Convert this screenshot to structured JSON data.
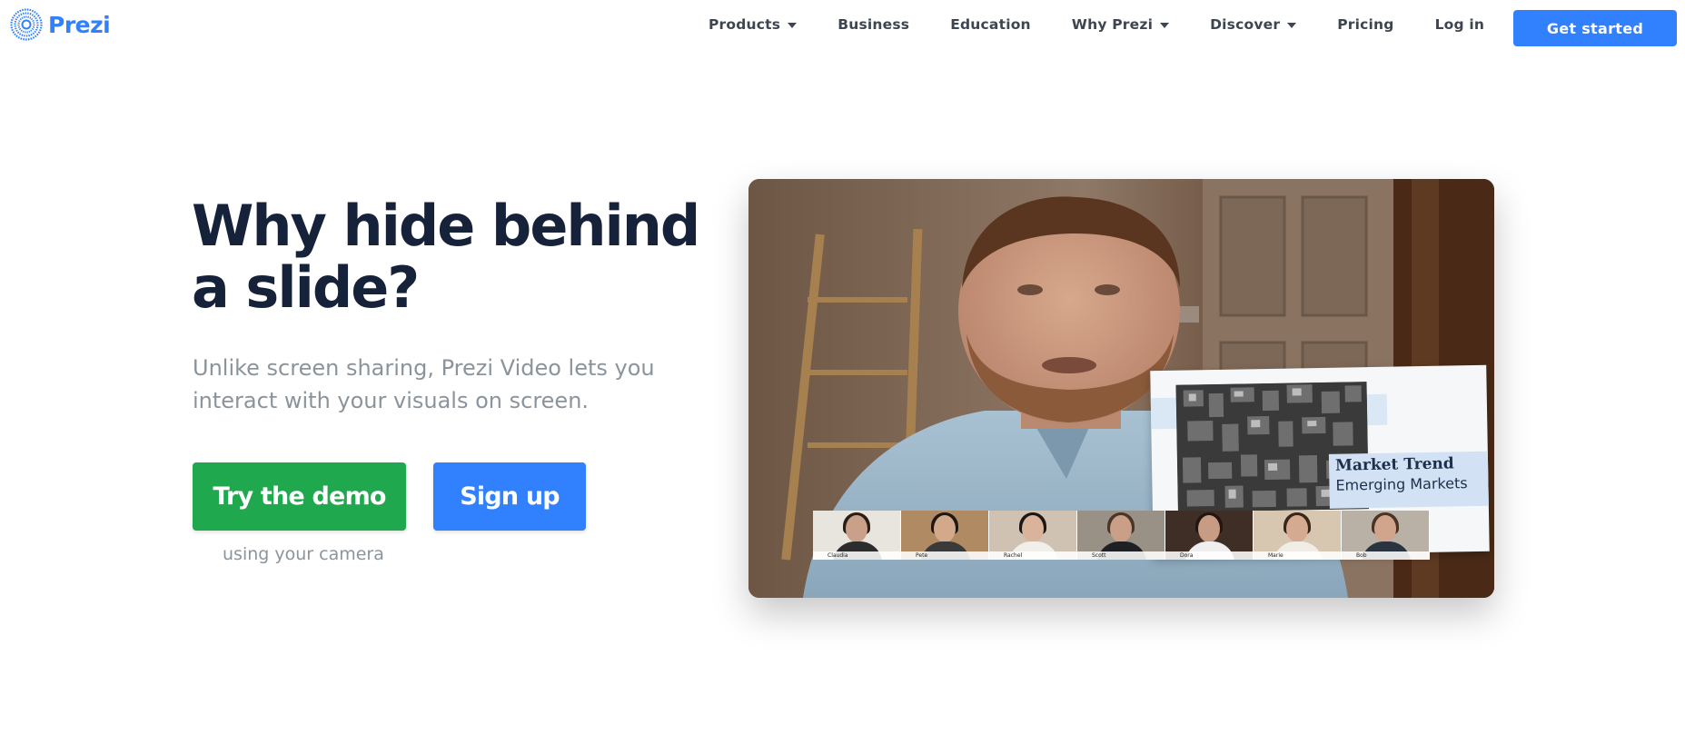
{
  "brand": {
    "name": "Prezi",
    "logo_icon": "prezi-logo-icon",
    "color": "#3181ff"
  },
  "nav": {
    "items": [
      {
        "label": "Products",
        "dropdown": true
      },
      {
        "label": "Business",
        "dropdown": false
      },
      {
        "label": "Education",
        "dropdown": false
      },
      {
        "label": "Why Prezi",
        "dropdown": true
      },
      {
        "label": "Discover",
        "dropdown": true
      },
      {
        "label": "Pricing",
        "dropdown": false
      },
      {
        "label": "Log in",
        "dropdown": false
      }
    ],
    "cta": "Get started"
  },
  "hero": {
    "title": "Why hide behind a slide?",
    "subtitle": "Unlike screen sharing, Prezi Video lets you interact with your visuals on screen.",
    "primary_button": "Try the demo",
    "primary_button_color": "#1fa84e",
    "secondary_button": "Sign up",
    "secondary_button_color": "#3181ff",
    "primary_note": "using your camera"
  },
  "video": {
    "slide": {
      "title": "Market Trend",
      "subtitle": "Emerging Markets"
    },
    "participants": [
      "Claudia",
      "Pete",
      "Rachel",
      "Scott",
      "Dora",
      "Marie",
      "Bob"
    ]
  }
}
